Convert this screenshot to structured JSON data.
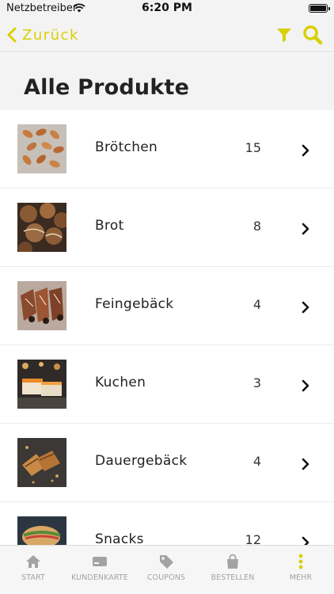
{
  "status_bar": {
    "carrier": "Netzbetreiber",
    "time": "6:20 PM"
  },
  "nav": {
    "back_label": "Zurück",
    "accent_color": "#d8d000"
  },
  "page": {
    "title": "Alle Produkte"
  },
  "products": [
    {
      "name": "Brötchen",
      "count": "15",
      "thumb_icon": "rolls-photo"
    },
    {
      "name": "Brot",
      "count": "8",
      "thumb_icon": "bread-photo"
    },
    {
      "name": "Feingebäck",
      "count": "4",
      "thumb_icon": "pastry-photo"
    },
    {
      "name": "Kuchen",
      "count": "3",
      "thumb_icon": "cake-photo"
    },
    {
      "name": "Dauergebäck",
      "count": "4",
      "thumb_icon": "cookie-photo"
    },
    {
      "name": "Snacks",
      "count": "12",
      "thumb_icon": "snack-photo"
    }
  ],
  "tabbar": {
    "items": [
      {
        "label": "START",
        "icon": "home-icon"
      },
      {
        "label": "KUNDENKARTE",
        "icon": "card-icon"
      },
      {
        "label": "COUPONS",
        "icon": "tag-icon"
      },
      {
        "label": "BESTELLEN",
        "icon": "bag-icon"
      },
      {
        "label": "MEHR",
        "icon": "more-icon",
        "active_color": "#d8d000"
      }
    ]
  }
}
